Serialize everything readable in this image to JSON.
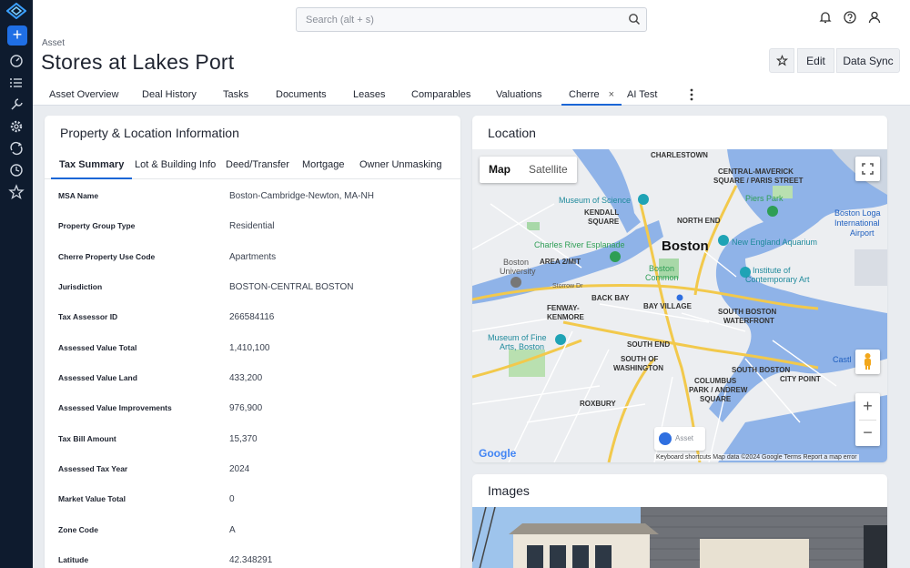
{
  "search": {
    "placeholder": "Search (alt + s)"
  },
  "header": {
    "breadcrumb": "Asset",
    "title": "Stores at Lakes Port"
  },
  "actions": {
    "edit_label": "Edit",
    "sync_label": "Data Sync"
  },
  "tabs": [
    {
      "label": "Asset Overview"
    },
    {
      "label": "Deal History"
    },
    {
      "label": "Tasks"
    },
    {
      "label": "Documents"
    },
    {
      "label": "Leases"
    },
    {
      "label": "Comparables"
    },
    {
      "label": "Valuations"
    },
    {
      "label": "Cherre",
      "closable": "×"
    },
    {
      "label": "AI Test"
    }
  ],
  "property_panel": {
    "title": "Property & Location Information",
    "subtabs": [
      {
        "label": "Tax Summary"
      },
      {
        "label": "Lot & Building Info"
      },
      {
        "label": "Deed/Transfer"
      },
      {
        "label": "Mortgage"
      },
      {
        "label": "Owner Unmasking"
      }
    ],
    "rows": [
      {
        "label": "MSA Name",
        "value": "Boston-Cambridge-Newton, MA-NH"
      },
      {
        "label": "Property Group Type",
        "value": "Residential"
      },
      {
        "label": "Cherre Property Use Code",
        "value": "Apartments"
      },
      {
        "label": "Jurisdiction",
        "value": "BOSTON-CENTRAL BOSTON"
      },
      {
        "label": "Tax Assessor ID",
        "value": "266584116"
      },
      {
        "label": "Assessed Value Total",
        "value": "1,410,100"
      },
      {
        "label": "Assessed Value Land",
        "value": "433,200"
      },
      {
        "label": "Assessed Value Improvements",
        "value": "976,900"
      },
      {
        "label": "Tax Bill Amount",
        "value": "15,370"
      },
      {
        "label": "Assessed Tax Year",
        "value": "2024"
      },
      {
        "label": "Market Value Total",
        "value": "0"
      },
      {
        "label": "Zone Code",
        "value": "A"
      },
      {
        "label": "Latitude",
        "value": "42.348291"
      }
    ]
  },
  "location_panel": {
    "title": "Location",
    "map_type": {
      "map": "Map",
      "satellite": "Satellite"
    },
    "labels": {
      "charlestown": "CHARLESTOWN",
      "central_maverick": "CENTRAL-MAVERICK",
      "square_paris": "SQUARE / PARIS STREET",
      "museum_science": "Museum of Science",
      "piers_park": "Piers Park",
      "kendall": "KENDALL",
      "square": "SQUARE",
      "north_end": "NORTH END",
      "boston_logan": "Boston Loga",
      "international": "International",
      "airport": "Airport",
      "esplanade": "Charles River Esplanade",
      "boston": "Boston",
      "aquarium": "New England Aquarium",
      "area2mit": "AREA 2/MIT",
      "boston_univ1": "Boston",
      "boston_univ2": "University",
      "boston_common1": "Boston",
      "boston_common2": "Common",
      "ica1": "Institute of",
      "ica2": "Contemporary Art",
      "back_bay": "BACK BAY",
      "fenway": "FENWAY-",
      "kenmore": "KENMORE",
      "bay_village": "BAY VILLAGE",
      "south_boston": "SOUTH BOSTON",
      "waterfront": "WATERFRONT",
      "mfa1": "Museum of Fine",
      "mfa2": "Arts, Boston",
      "south_end": "SOUTH END",
      "south_of": "SOUTH OF",
      "washington": "WASHINGTON",
      "south_boston2": "SOUTH BOSTON",
      "city_point": "CITY POINT",
      "castle": "Castl",
      "columbus": "COLUMBUS",
      "park_andrew": "PARK / ANDREW",
      "square2": "SQUARE",
      "roxbury": "ROXBURY",
      "storrow": "Storrow Dr"
    },
    "legend": "Asset",
    "google": "Google",
    "attribution": "Keyboard shortcuts    Map data ©2024 Google    Terms    Report a map error"
  },
  "images_panel": {
    "title": "Images"
  },
  "colors": {
    "accent": "#1a66d6",
    "rail": "#0e1b2e",
    "add_button": "#1f6fe5"
  }
}
